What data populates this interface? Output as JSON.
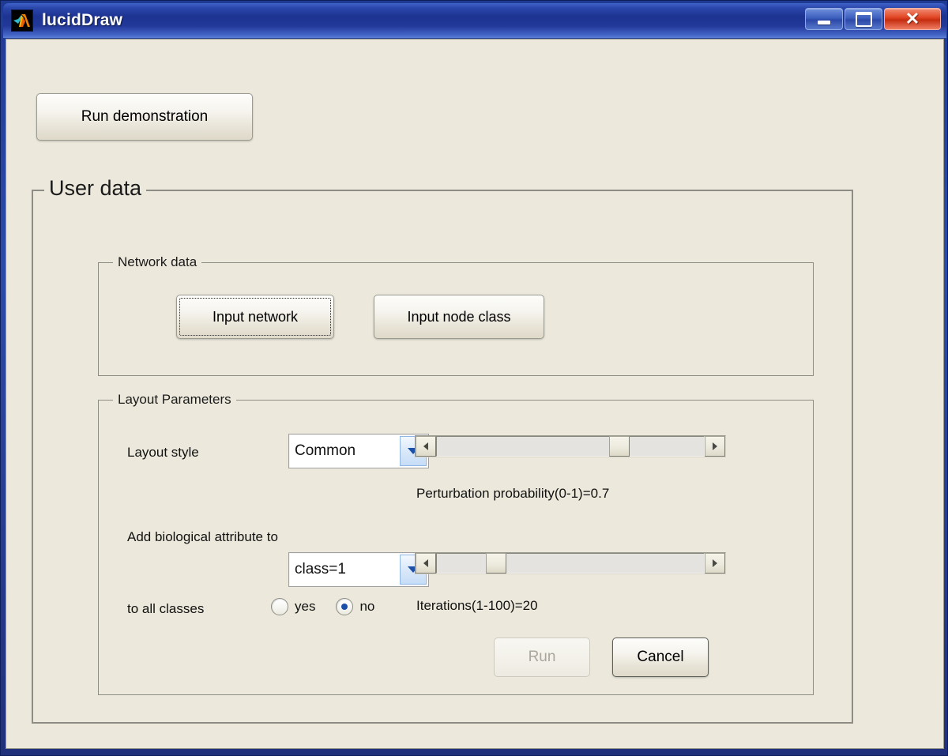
{
  "window": {
    "title": "lucidDraw",
    "icon": "matlab-icon",
    "controls": {
      "minimize": "minimize-icon",
      "maximize": "maximize-icon",
      "close": "close-icon"
    },
    "accent_color": "#1f3a93",
    "close_color": "#c62d10",
    "background_color": "#ece9dc"
  },
  "toolbar": {
    "run_demo_label": "Run demonstration"
  },
  "user_data_panel": {
    "title": "User data",
    "network_panel": {
      "title": "Network data",
      "input_network_label": "Input network",
      "input_network_focused": true,
      "input_node_class_label": "Input node class"
    },
    "layout_panel": {
      "title": "Layout Parameters",
      "layout_style_label": "Layout style",
      "layout_style_value": "Common",
      "layout_style_options": [
        "Common"
      ],
      "attribute_label": "Add biological attribute to",
      "class_select_value": "class=1",
      "class_select_options": [
        "class=1"
      ],
      "all_classes_label": "to all classes",
      "radio_yes_label": "yes",
      "radio_no_label": "no",
      "radio_selected": "no",
      "perturbation": {
        "caption": "Perturbation probability(0-1)=0.7",
        "value": 0.7,
        "min": 0,
        "max": 1,
        "thumb_percent": 70
      },
      "iterations": {
        "caption": "Iterations(1-100)=20",
        "value": 20,
        "min": 1,
        "max": 100,
        "thumb_percent": 20
      },
      "run_label": "Run",
      "run_disabled": true,
      "cancel_label": "Cancel"
    }
  }
}
